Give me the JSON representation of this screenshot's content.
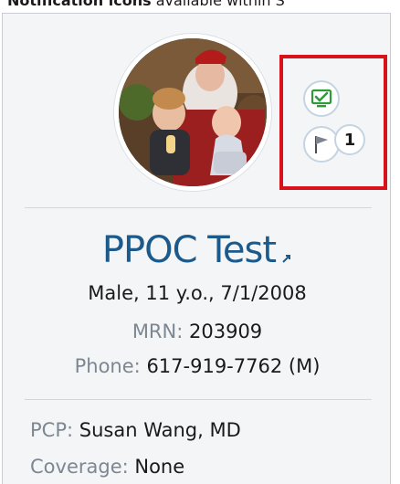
{
  "caption": {
    "bold": "Notification icons",
    "text": " available within S"
  },
  "patient": {
    "name": "PPOC Test",
    "demographics": "Male, 11 y.o., 7/1/2008",
    "mrn_label": "MRN:",
    "mrn_value": "203909",
    "phone_label": "Phone:",
    "phone_value": "617-919-7762 (M)",
    "pcp_label": "PCP:",
    "pcp_value": "Susan Wang, MD",
    "coverage_label": "Coverage:",
    "coverage_value": "None"
  },
  "notifications": {
    "flag_count": "1",
    "icons": [
      "monitor-check-icon",
      "flag-icon"
    ]
  },
  "colors": {
    "name": "#1c5a8c",
    "highlight": "#d8121a",
    "monitor_green": "#2e9a3a",
    "label_gray": "#7d8792"
  }
}
